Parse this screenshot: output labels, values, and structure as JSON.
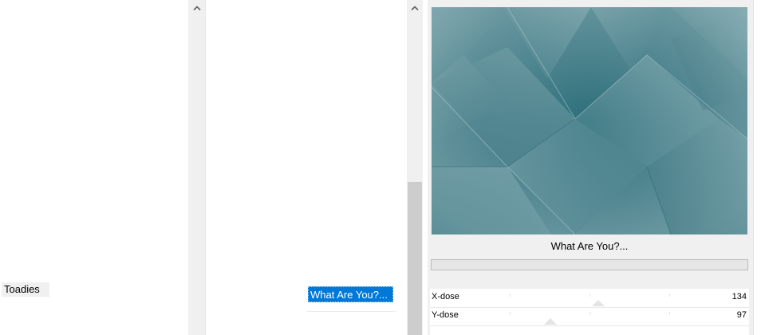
{
  "categories": {
    "selected_label": "Toadies"
  },
  "filters": {
    "selected_label": "What Are You?..."
  },
  "preview": {
    "title": "What Are You?...",
    "progress_fraction": 0
  },
  "params": [
    {
      "label": "X-dose",
      "value": "134"
    },
    {
      "label": "Y-dose",
      "value": "97"
    }
  ]
}
